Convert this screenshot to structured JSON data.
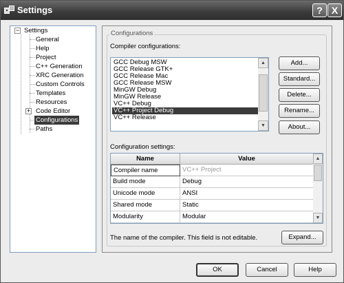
{
  "window": {
    "title": "Settings"
  },
  "titlebar": {
    "help_glyph": "?",
    "close_glyph": "X"
  },
  "tree": {
    "root_label": "Settings",
    "items": [
      {
        "label": "General"
      },
      {
        "label": "Help"
      },
      {
        "label": "Project"
      },
      {
        "label": "C++ Generation"
      },
      {
        "label": "XRC Generation"
      },
      {
        "label": "Custom Controls"
      },
      {
        "label": "Templates"
      },
      {
        "label": "Resources"
      },
      {
        "label": "Code Editor"
      },
      {
        "label": "Configurations",
        "selected": true
      },
      {
        "label": "Paths"
      }
    ]
  },
  "panel": {
    "group_title": "Configurations",
    "compiler_label": "Compiler configurations:",
    "compiler_list": [
      "GCC Debug MSW",
      "GCC Release GTK+",
      "GCC Release Mac",
      "GCC Release MSW",
      "MinGW Debug",
      "MinGW Release",
      "VC++ Debug",
      "VC++ Project Debug",
      "VC++ Release"
    ],
    "compiler_selected": "VC++ Project Debug",
    "buttons": {
      "add": "Add...",
      "standard": "Standard...",
      "delete": "Delete...",
      "rename": "Rename...",
      "about": "About..."
    },
    "settings_label": "Configuration settings:",
    "grid": {
      "headers": [
        "Name",
        "Value"
      ],
      "rows": [
        {
          "name": "Compiler name",
          "value": "VC++ Project"
        },
        {
          "name": "Build mode",
          "value": "Debug"
        },
        {
          "name": "Unicode mode",
          "value": "ANSI"
        },
        {
          "name": "Shared mode",
          "value": "Static"
        },
        {
          "name": "Modularity",
          "value": "Modular"
        }
      ]
    },
    "help_text": "The name of the compiler. This field is not editable.",
    "expand_button": "Expand..."
  },
  "footer": {
    "ok": "OK",
    "cancel": "Cancel",
    "help": "Help"
  }
}
